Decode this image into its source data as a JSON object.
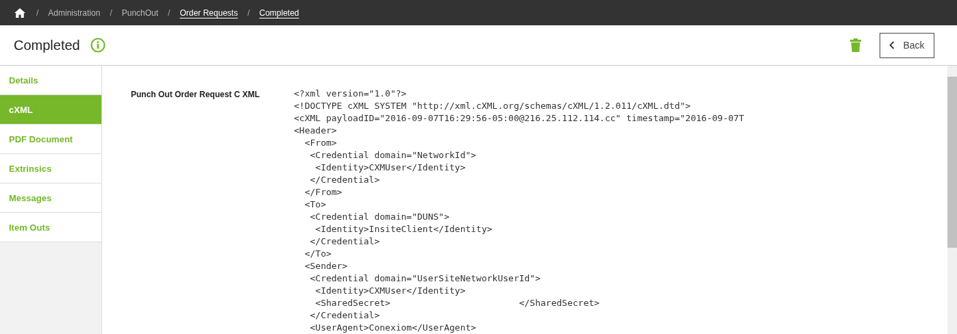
{
  "breadcrumb": [
    {
      "label": "Administration",
      "link": false
    },
    {
      "label": "PunchOut",
      "link": false
    },
    {
      "label": "Order Requests",
      "link": true
    },
    {
      "label": "Completed",
      "link": true
    }
  ],
  "breadcrumb_separator": "/",
  "page_title": "Completed",
  "back_button": "Back",
  "sidebar": {
    "items": [
      {
        "label": "Details",
        "selected": false
      },
      {
        "label": "cXML",
        "selected": true
      },
      {
        "label": "PDF Document",
        "selected": false
      },
      {
        "label": "Extrinsics",
        "selected": false
      },
      {
        "label": "Messages",
        "selected": false
      },
      {
        "label": "Item Outs",
        "selected": false
      }
    ]
  },
  "field": {
    "label": "Punch Out Order Request C XML",
    "lines": [
      "<?xml version=\"1.0\"?>",
      "<!DOCTYPE cXML SYSTEM \"http://xml.cXML.org/schemas/cXML/1.2.011/cXML.dtd\">",
      "<cXML payloadID=\"2016-09-07T16:29:56-05:00@216.25.112.114.cc\" timestamp=\"2016-09-07T",
      "<Header>",
      "  <From>",
      "   <Credential domain=\"NetworkId\">",
      "    <Identity>CXMUser</Identity>",
      "   </Credential>",
      "  </From>",
      "  <To>",
      "   <Credential domain=\"DUNS\">",
      "    <Identity>InsiteClient</Identity>",
      "   </Credential>",
      "  </To>",
      "  <Sender>",
      "   <Credential domain=\"UserSiteNetworkUserId\">",
      "    <Identity>CXMUser</Identity>",
      "    <SharedSecret>                        </SharedSecret>",
      "   </Credential>",
      "   <UserAgent>Conexiom</UserAgent>"
    ]
  }
}
